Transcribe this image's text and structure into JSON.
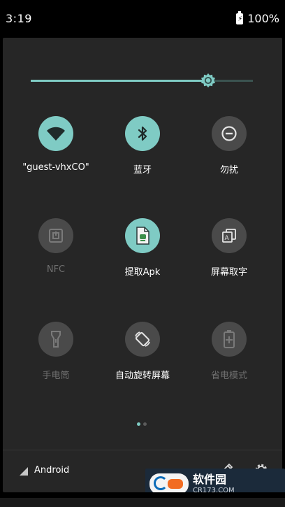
{
  "statusbar": {
    "time": "3:19",
    "battery_percent": "100%",
    "battery_icon": "battery-charging-icon"
  },
  "brightness": {
    "level": 0.8,
    "thumb_icon": "brightness-sun-icon"
  },
  "tiles": [
    {
      "label": "\"guest-vhxCO\"",
      "icon": "wifi-icon",
      "active": true
    },
    {
      "label": "蓝牙",
      "icon": "bluetooth-icon",
      "active": true
    },
    {
      "label": "勿扰",
      "icon": "do-not-disturb-icon",
      "active": false
    },
    {
      "label": "NFC",
      "icon": "nfc-icon",
      "active": false
    },
    {
      "label": "提取Apk",
      "icon": "apk-file-icon",
      "active": true
    },
    {
      "label": "屏幕取字",
      "icon": "screen-text-icon",
      "active": false
    },
    {
      "label": "手电筒",
      "icon": "flashlight-icon",
      "active": false
    },
    {
      "label": "自动旋转屏幕",
      "icon": "auto-rotate-icon",
      "active": false
    },
    {
      "label": "省电模式",
      "icon": "battery-saver-icon",
      "active": false
    }
  ],
  "pager": {
    "pages": 2,
    "current": 1
  },
  "footer": {
    "carrier": "Android",
    "edit_icon": "pencil-icon",
    "settings_icon": "gear-icon"
  },
  "watermark": {
    "title": "软件园",
    "subtitle": "CR173.COM"
  },
  "colors": {
    "accent": "#7fcbc4",
    "panel_bg": "#262626",
    "inactive_circle": "#4a4a4a",
    "dim_text": "#6f6f6f"
  }
}
